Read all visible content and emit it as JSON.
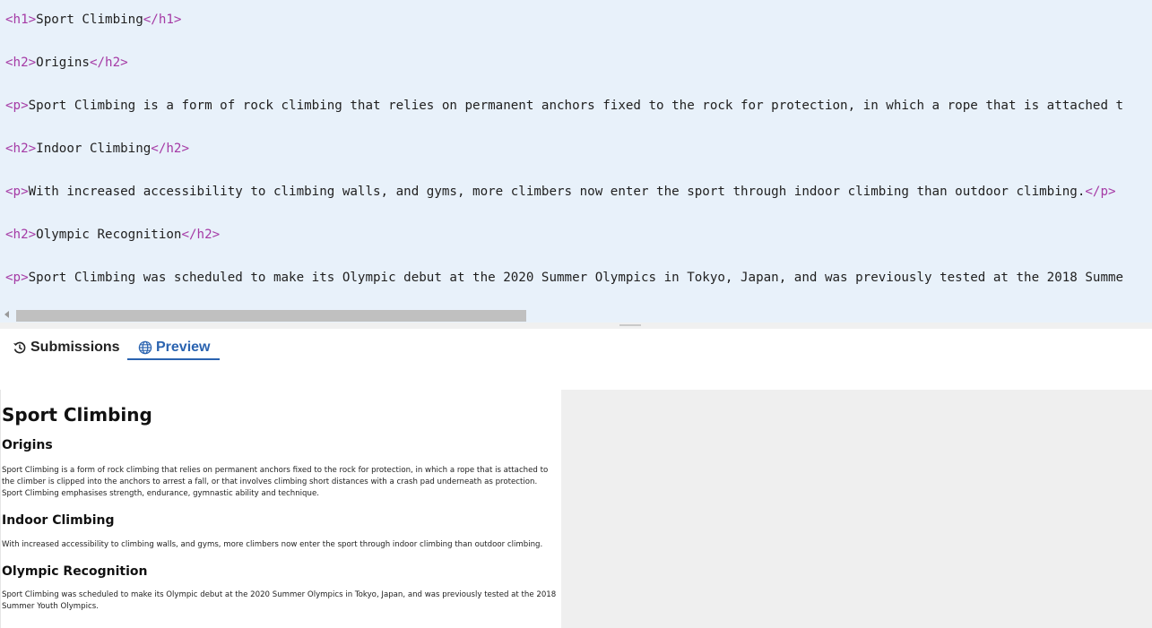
{
  "editor": {
    "lines": [
      {
        "open": "<h1>",
        "text": "Sport Climbing",
        "close": "</h1>"
      },
      {
        "open": "<h2>",
        "text": "Origins",
        "close": "</h2>"
      },
      {
        "open": "<p>",
        "text": "Sport Climbing is a form of rock climbing that relies on permanent anchors fixed to the rock for protection, in which a rope that is attached t",
        "close": ""
      },
      {
        "open": "<h2>",
        "text": "Indoor Climbing",
        "close": "</h2>"
      },
      {
        "open": "<p>",
        "text": "With increased accessibility to climbing walls, and gyms, more climbers now enter the sport through indoor climbing than outdoor climbing.",
        "close": "</p>"
      },
      {
        "open": "<h2>",
        "text": "Olympic Recognition",
        "close": "</h2>"
      },
      {
        "open": "<p>",
        "text": "Sport Climbing was scheduled to make its Olympic debut at the 2020 Summer Olympics in Tokyo, Japan, and was previously tested at the 2018 Summe",
        "close": ""
      }
    ]
  },
  "tabs": {
    "submissions": {
      "label": "Submissions",
      "icon": "history-icon"
    },
    "preview": {
      "label": "Preview",
      "icon": "globe-icon",
      "active": true
    }
  },
  "preview": {
    "title": "Sport Climbing",
    "origins_heading": "Origins",
    "origins_text": "Sport Climbing is a form of rock climbing that relies on permanent anchors fixed to the rock for protection, in which a rope that is attached to the climber is clipped into the anchors to arrest a fall, or that involves climbing short distances with a crash pad underneath as protection. Sport Climbing emphasises strength, endurance, gymnastic ability and technique.",
    "indoor_heading": "Indoor Climbing",
    "indoor_text": "With increased accessibility to climbing walls, and gyms, more climbers now enter the sport through indoor climbing than outdoor climbing.",
    "olympic_heading": "Olympic Recognition",
    "olympic_text": "Sport Climbing was scheduled to make its Olympic debut at the 2020 Summer Olympics in Tokyo, Japan, and was previously tested at the 2018 Summer Youth Olympics."
  },
  "colors": {
    "editor_bg": "#e8f1fa",
    "tag": "#a53aa5",
    "accent": "#2a63b0"
  }
}
